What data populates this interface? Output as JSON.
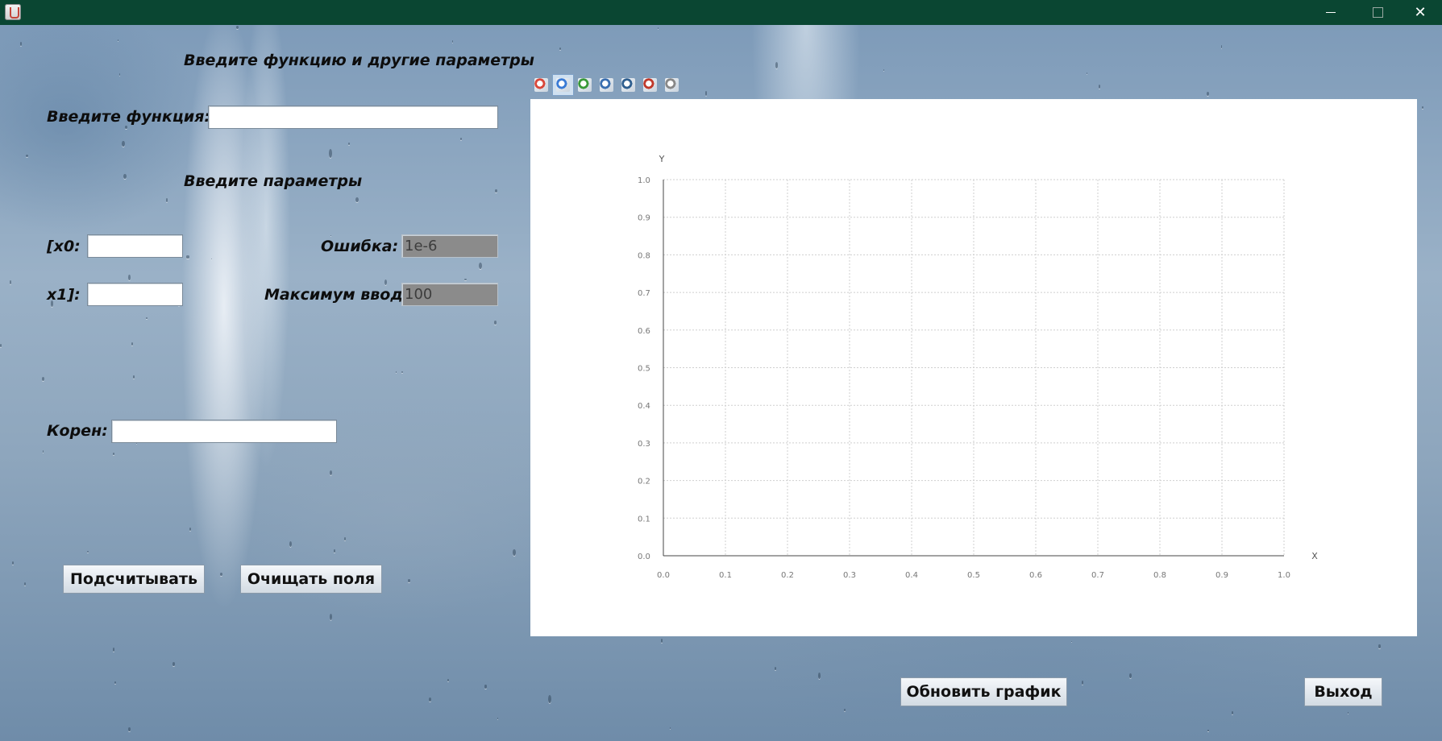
{
  "window": {
    "controls": {
      "minimize_icon": "minimize-icon",
      "maximize_icon": "maximize-icon",
      "close_icon": "close-icon",
      "close_glyph": "✕"
    }
  },
  "form": {
    "heading": "Введите функцию и другие параметры",
    "function_label": "Введите функция:",
    "function_value": "",
    "params_heading": "Введите параметры",
    "x0_label": "[x0:",
    "x0_value": "",
    "x1_label": "x1]:",
    "x1_value": "",
    "error_label": "Ошибка:",
    "error_value": "1e-6",
    "max_label": "Максимум ввод:",
    "max_value": "100",
    "root_label": "Корен:",
    "root_value": ""
  },
  "buttons": {
    "calculate": "Подсчитывать",
    "clear": "Очищать поля",
    "update_chart": "Обновить график",
    "exit": "Выход"
  },
  "toolbar": {
    "tools": [
      {
        "icon": "zoom-fit-icon",
        "color": "#d9473a"
      },
      {
        "icon": "zoom-icon",
        "color": "#3a7bd5",
        "active": true
      },
      {
        "icon": "zoom-area-icon",
        "color": "#3a9a3a"
      },
      {
        "icon": "pan-icon",
        "color": "#3a6fb0"
      },
      {
        "icon": "chart-edit-icon",
        "color": "#2f5f8f"
      },
      {
        "icon": "save-image-icon",
        "color": "#c0392b"
      },
      {
        "icon": "grid-icon",
        "color": "#888888"
      }
    ]
  },
  "chart_data": {
    "type": "line",
    "series": [],
    "xlabel": "X",
    "ylabel": "Y",
    "xlim": [
      0.0,
      1.0
    ],
    "ylim": [
      0.0,
      1.0
    ],
    "xticks": [
      "0.0",
      "0.1",
      "0.2",
      "0.3",
      "0.4",
      "0.5",
      "0.6",
      "0.7",
      "0.8",
      "0.9",
      "1.0"
    ],
    "yticks": [
      "0.0",
      "0.1",
      "0.2",
      "0.3",
      "0.4",
      "0.5",
      "0.6",
      "0.7",
      "0.8",
      "0.9",
      "1.0"
    ],
    "grid": true
  }
}
